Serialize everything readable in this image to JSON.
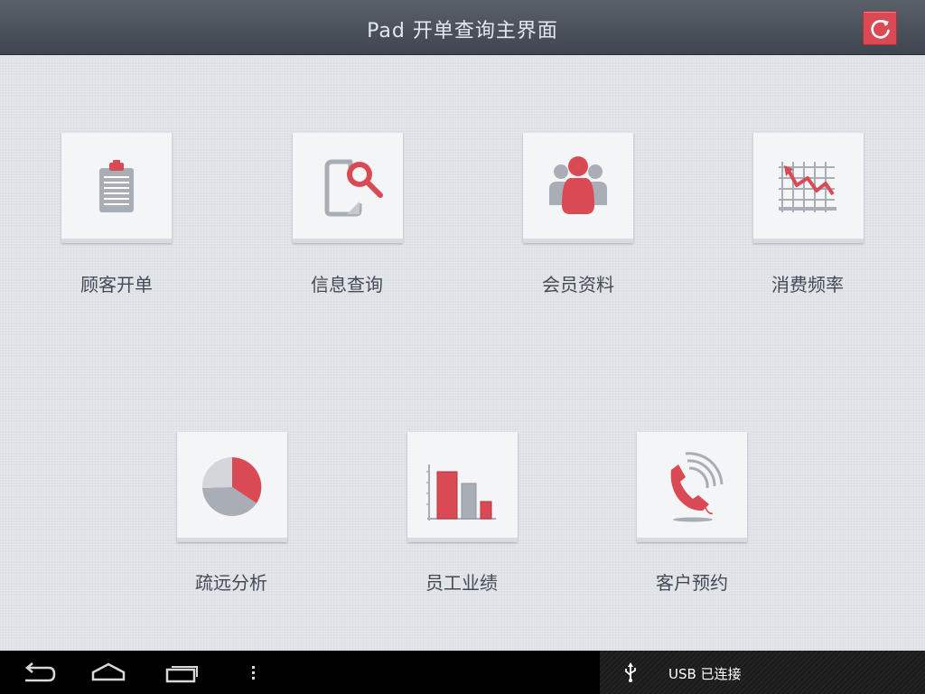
{
  "header": {
    "title": "Pad 开单查询主界面"
  },
  "tiles": [
    {
      "label": "顾客开单",
      "icon": "clipboard-icon"
    },
    {
      "label": "信息查询",
      "icon": "document-search-icon"
    },
    {
      "label": "会员资料",
      "icon": "members-icon"
    },
    {
      "label": "消费频率",
      "icon": "trend-chart-icon"
    },
    {
      "label": "疏远分析",
      "icon": "pie-chart-icon"
    },
    {
      "label": "员工业绩",
      "icon": "bar-chart-icon"
    },
    {
      "label": "客户预约",
      "icon": "phone-icon"
    }
  ],
  "colors": {
    "accent": "#d94a55",
    "gray": "#a9adb5",
    "title_bg": "#4a5059"
  },
  "statusbar": {
    "usb_text": "USB 已连接"
  }
}
